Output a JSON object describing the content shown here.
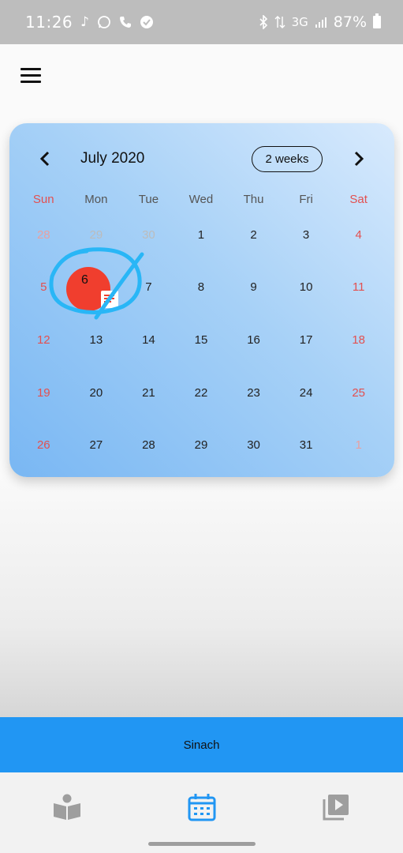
{
  "status_bar": {
    "time": "11:26",
    "network": "3G",
    "battery": "87%"
  },
  "app_bar": {
    "menu_icon": "menu-icon"
  },
  "calendar": {
    "month_title": "July 2020",
    "format_button": "2 weeks",
    "weekdays": [
      "Sun",
      "Mon",
      "Tue",
      "Wed",
      "Thu",
      "Fri",
      "Sat"
    ],
    "weeks": [
      [
        "28",
        "29",
        "30",
        "1",
        "2",
        "3",
        "4"
      ],
      [
        "5",
        "6",
        "7",
        "8",
        "9",
        "10",
        "11"
      ],
      [
        "12",
        "13",
        "14",
        "15",
        "16",
        "17",
        "18"
      ],
      [
        "19",
        "20",
        "21",
        "22",
        "23",
        "24",
        "25"
      ],
      [
        "26",
        "27",
        "28",
        "29",
        "30",
        "31",
        "1"
      ]
    ],
    "selected_day": "6",
    "colors": {
      "selected": "#f03e2e",
      "weekend": "#e35050",
      "outside": "#bcbcbc",
      "scribble": "#29b6f6"
    }
  },
  "player_bar": {
    "label": "Sinach",
    "color": "#2196f3"
  },
  "bottom_nav": {
    "items": [
      {
        "icon": "book-reader-icon",
        "active": false
      },
      {
        "icon": "calendar-icon",
        "active": true
      },
      {
        "icon": "video-library-icon",
        "active": false
      }
    ],
    "active_color": "#2196f3",
    "inactive_color": "#9e9e9e"
  }
}
